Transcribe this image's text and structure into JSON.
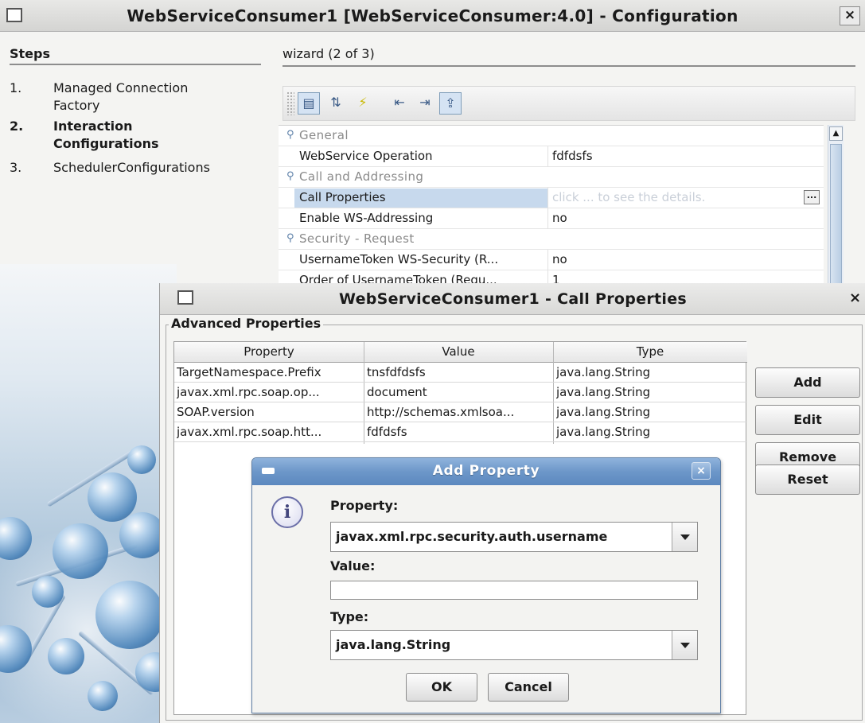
{
  "main_window": {
    "title": "WebServiceConsumer1 [WebServiceConsumer:4.0] - Configuration",
    "close_label": "×"
  },
  "steps": {
    "heading": "Steps",
    "items": [
      {
        "num": "1.",
        "label_line1": "Managed Connection",
        "label_line2": "Factory"
      },
      {
        "num": "2.",
        "label_line1": "Interaction",
        "label_line2": "Configurations"
      },
      {
        "num": "3.",
        "label_line1": "SchedulerConfigurations",
        "label_line2": ""
      }
    ],
    "active_index": 1
  },
  "wizard": {
    "heading": "wizard (2 of 3)",
    "toolbar": {
      "icons": [
        "categorized-view-icon",
        "sort-alphabetical-icon",
        "lightning-icon",
        "collapse-icon",
        "expand-icon",
        "export-icon"
      ],
      "glyphs": [
        "▤",
        "⇅",
        "⚡",
        "⇤",
        "⇥",
        "⇪"
      ]
    },
    "property_sheet": {
      "rows": [
        {
          "kind": "category",
          "label": "General"
        },
        {
          "kind": "prop",
          "name": "WebService Operation",
          "value": "fdfdsfs"
        },
        {
          "kind": "category",
          "label": "Call and Addressing"
        },
        {
          "kind": "prop",
          "name": "Call Properties",
          "value": "click ... to see the details.",
          "selected": true,
          "ellipsis": "..."
        },
        {
          "kind": "prop",
          "name": "Enable WS-Addressing",
          "value": "no"
        },
        {
          "kind": "category",
          "label": "Security - Request"
        },
        {
          "kind": "prop",
          "name": "UsernameToken WS-Security (R...",
          "value": "no"
        },
        {
          "kind": "prop",
          "name": "Order of UsernameToken (Requ...",
          "value": "1"
        }
      ]
    }
  },
  "call_properties_dialog": {
    "title": "WebServiceConsumer1 - Call Properties",
    "close_label": "×",
    "group_label": "Advanced Properties",
    "columns": [
      "Property",
      "Value",
      "Type"
    ],
    "rows": [
      [
        "TargetNamespace.Prefix",
        "tnsfdfdsfs",
        "java.lang.String"
      ],
      [
        "javax.xml.rpc.soap.op...",
        "document",
        "java.lang.String"
      ],
      [
        "SOAP.version",
        "http://schemas.xmlsoa...",
        "java.lang.String"
      ],
      [
        "javax.xml.rpc.soap.htt...",
        "fdfdsfs",
        "java.lang.String"
      ]
    ],
    "buttons": [
      "Add",
      "Edit",
      "Remove",
      "Reset"
    ]
  },
  "add_property_dialog": {
    "title": "Add Property",
    "close_label": "×",
    "info_glyph": "i",
    "property_label": "Property:",
    "property_value": "javax.xml.rpc.security.auth.username",
    "value_label": "Value:",
    "value_value": "",
    "type_label": "Type:",
    "type_value": "java.lang.String",
    "ok_label": "OK",
    "cancel_label": "Cancel"
  }
}
